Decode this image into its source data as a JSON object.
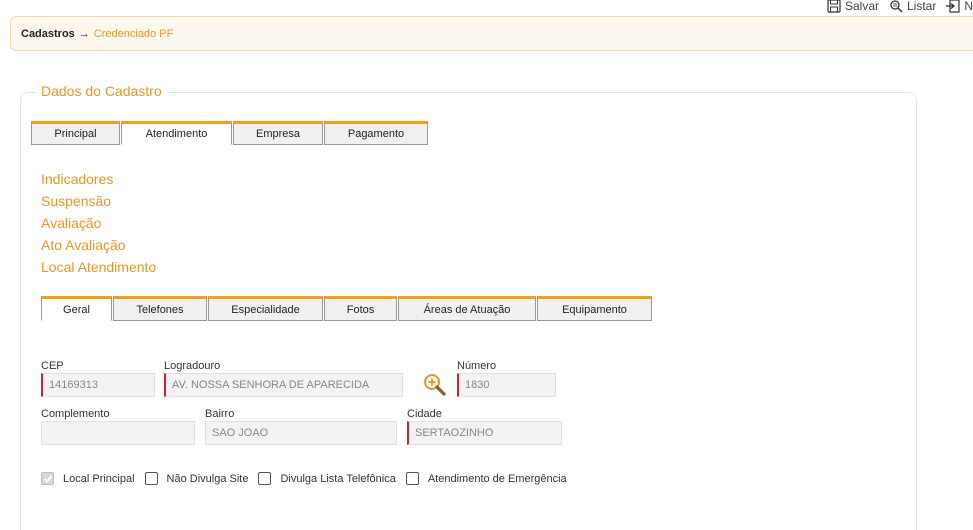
{
  "toolbar": {
    "salvar": "Salvar",
    "listar": "Listar",
    "novo": "N"
  },
  "breadcrumb": {
    "root": "Cadastros",
    "arrow": "→",
    "current": "Credenciado PF"
  },
  "section": {
    "legend": "Dados do Cadastro"
  },
  "top_tabs": [
    "Principal",
    "Atendimento",
    "Empresa",
    "Pagamento"
  ],
  "links": [
    "Indicadores",
    "Suspensão",
    "Avaliação",
    "Ato Avaliação",
    "Local Atendimento"
  ],
  "inner_tabs": [
    "Geral",
    "Telefones",
    "Especialidade",
    "Fotos",
    "Áreas de Atuação",
    "Equipamento"
  ],
  "form": {
    "cep": {
      "label": "CEP",
      "value": "14169313"
    },
    "logradouro": {
      "label": "Logradouro",
      "value": "AV. NOSSA SENHORA DE APARECIDA"
    },
    "numero": {
      "label": "Número",
      "value": "1830"
    },
    "complemento": {
      "label": "Complemento",
      "value": ""
    },
    "bairro": {
      "label": "Bairro",
      "value": "SAO JOAO"
    },
    "cidade": {
      "label": "Cidade",
      "value": "SERTAOZINHO"
    }
  },
  "checks": {
    "local_principal": "Local Principal",
    "nao_divulga_site": "Não Divulga Site",
    "divulga_lista": "Divulga Lista Telefônica",
    "atendimento_emergencia": "Atendimento de Emergência"
  },
  "colors": {
    "accent": "#e8962b",
    "tab_border": "#f0a020",
    "required": "#d0202a"
  }
}
